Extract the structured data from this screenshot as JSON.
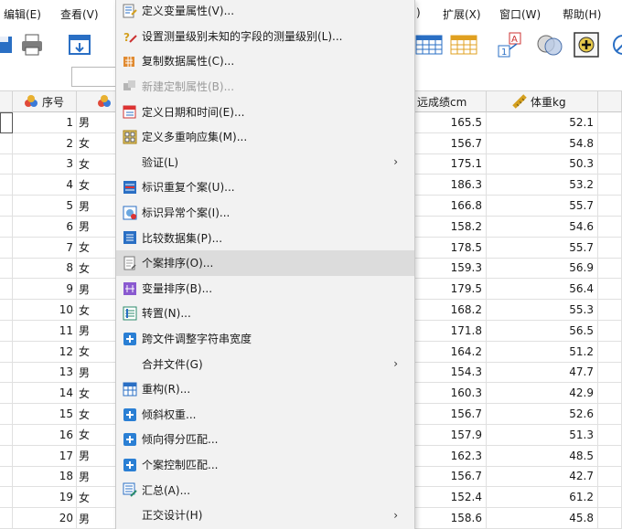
{
  "menubar": {
    "edit": "编辑(E)",
    "view": "查看(V)",
    "fragment": ")",
    "extensions": "扩展(X)",
    "window": "窗口(W)",
    "help": "帮助(H)"
  },
  "columns": {
    "seq": "序号",
    "long_jump": "远成绩cm",
    "weight": "体重kg"
  },
  "rows": [
    {
      "n": "1",
      "g": "男",
      "lj": "165.5",
      "w": "52.1"
    },
    {
      "n": "2",
      "g": "女",
      "lj": "156.7",
      "w": "54.8"
    },
    {
      "n": "3",
      "g": "女",
      "lj": "175.1",
      "w": "50.3"
    },
    {
      "n": "4",
      "g": "女",
      "lj": "186.3",
      "w": "53.2"
    },
    {
      "n": "5",
      "g": "男",
      "lj": "166.8",
      "w": "55.7"
    },
    {
      "n": "6",
      "g": "男",
      "lj": "158.2",
      "w": "54.6"
    },
    {
      "n": "7",
      "g": "女",
      "lj": "178.5",
      "w": "55.7"
    },
    {
      "n": "8",
      "g": "女",
      "lj": "159.3",
      "w": "56.9"
    },
    {
      "n": "9",
      "g": "男",
      "lj": "179.5",
      "w": "56.4"
    },
    {
      "n": "10",
      "g": "女",
      "lj": "168.2",
      "w": "55.3"
    },
    {
      "n": "11",
      "g": "男",
      "lj": "171.8",
      "w": "56.5"
    },
    {
      "n": "12",
      "g": "女",
      "lj": "164.2",
      "w": "51.2"
    },
    {
      "n": "13",
      "g": "男",
      "lj": "154.3",
      "w": "47.7"
    },
    {
      "n": "14",
      "g": "女",
      "lj": "160.3",
      "w": "42.9"
    },
    {
      "n": "15",
      "g": "女",
      "lj": "156.7",
      "w": "52.6"
    },
    {
      "n": "16",
      "g": "女",
      "lj": "157.9",
      "w": "51.3"
    },
    {
      "n": "17",
      "g": "男",
      "lj": "162.3",
      "w": "48.5"
    },
    {
      "n": "18",
      "g": "男",
      "lj": "156.7",
      "w": "42.7"
    },
    {
      "n": "19",
      "g": "女",
      "lj": "152.4",
      "w": "61.2"
    },
    {
      "n": "20",
      "g": "男",
      "lj": "158.6",
      "w": "45.8"
    }
  ],
  "menu": {
    "items": [
      {
        "label": "定义变量属性(V)...",
        "icon": "define-variable-properties-icon"
      },
      {
        "label": "设置测量级别未知的字段的测量级别(L)...",
        "icon": "set-measurement-level-icon"
      },
      {
        "label": "复制数据属性(C)...",
        "icon": "copy-data-properties-icon"
      },
      {
        "label": "新建定制属性(B)...",
        "icon": "new-custom-attribute-icon"
      },
      {
        "label": "定义日期和时间(E)...",
        "icon": "define-dates-icon"
      },
      {
        "label": "定义多重响应集(M)...",
        "icon": "define-multiple-response-icon"
      },
      {
        "label": "验证(L)",
        "icon": ""
      },
      {
        "label": "标识重复个案(U)...",
        "icon": "identify-duplicates-icon"
      },
      {
        "label": "标识异常个案(I)...",
        "icon": "identify-unusual-icon"
      },
      {
        "label": "比较数据集(P)...",
        "icon": "compare-datasets-icon"
      },
      {
        "label": "个案排序(O)...",
        "icon": "sort-cases-icon"
      },
      {
        "label": "变量排序(B)...",
        "icon": "sort-variables-icon"
      },
      {
        "label": "转置(N)...",
        "icon": "transpose-icon"
      },
      {
        "label": "跨文件调整字符串宽度",
        "icon": "plus-icon"
      },
      {
        "label": "合并文件(G)",
        "icon": ""
      },
      {
        "label": "重构(R)...",
        "icon": "restructure-icon"
      },
      {
        "label": "倾斜权重...",
        "icon": "plus-icon"
      },
      {
        "label": "倾向得分匹配...",
        "icon": "plus-icon"
      },
      {
        "label": "个案控制匹配...",
        "icon": "plus-icon"
      },
      {
        "label": "汇总(A)...",
        "icon": "aggregate-icon"
      },
      {
        "label": "正交设计(H)",
        "icon": ""
      }
    ],
    "submenu_arrow": "›"
  }
}
